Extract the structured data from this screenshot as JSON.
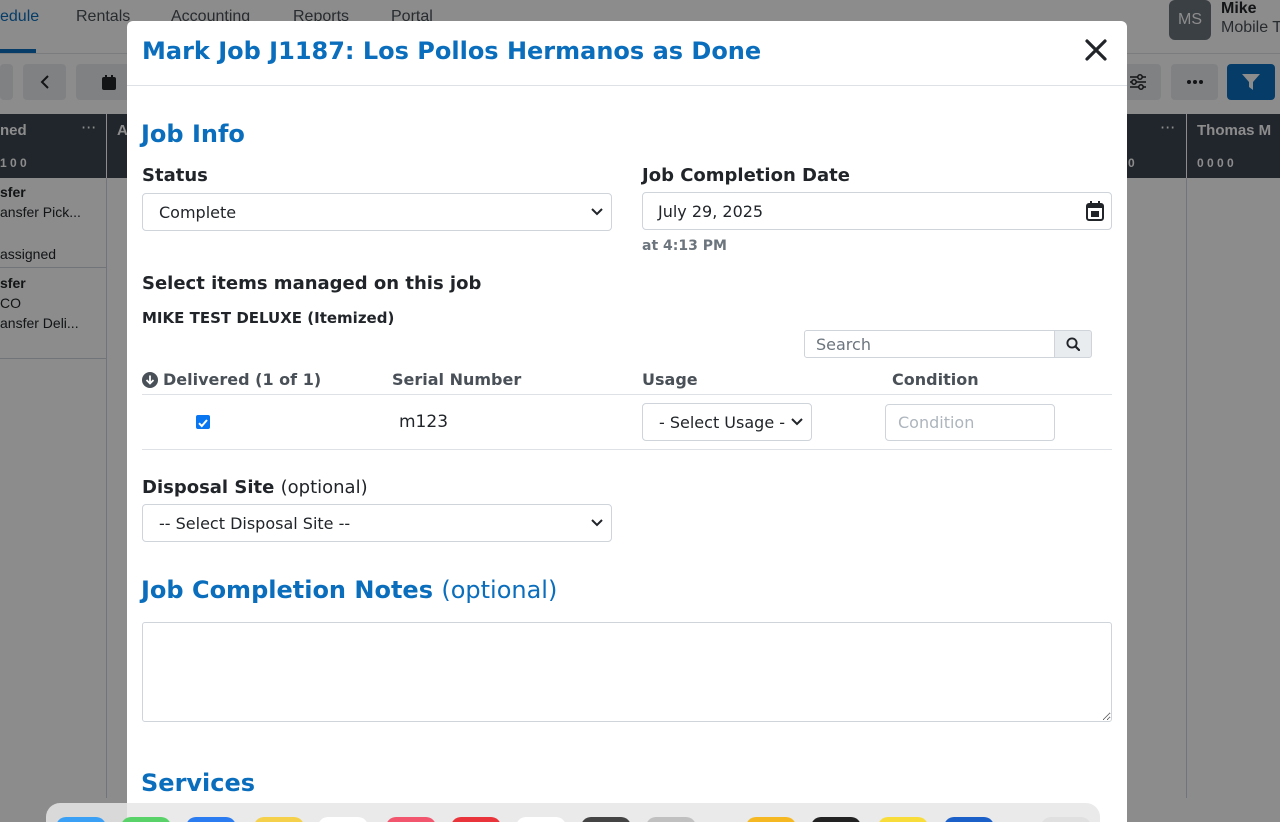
{
  "background": {
    "nav_tabs": [
      {
        "label": "edule"
      },
      {
        "label": "Rentals"
      },
      {
        "label": "Accounting"
      },
      {
        "label": "Reports"
      },
      {
        "label": "Portal"
      }
    ],
    "user": {
      "initials": "MS",
      "name": "Mike",
      "subtitle": "Mobile T"
    },
    "columns": [
      {
        "title": "ned",
        "counts": "1 0 0"
      },
      {
        "title": "A",
        "counts": ""
      },
      {
        "title": "",
        "counts": "0"
      },
      {
        "title": "Thomas M",
        "counts": "0 0 0 0"
      }
    ],
    "cards": [
      {
        "line1": "sfer",
        "line2": "ansfer Pick...",
        "line3": "assigned"
      },
      {
        "line1": "sfer",
        "line2": "CO",
        "line3": "ansfer Deli..."
      }
    ]
  },
  "modal": {
    "title": "Mark Job J1187: Los Pollos Hermanos as Done",
    "job_info": {
      "heading": "Job Info",
      "status_label": "Status",
      "status_value": "Complete",
      "completion_date_label": "Job Completion Date",
      "completion_date_value": "July 29, 2025",
      "completion_time": "at 4:13 PM"
    },
    "items": {
      "heading": "Select items managed on this job",
      "product": "MIKE TEST DELUXE (Itemized)",
      "search_placeholder": "Search",
      "columns": {
        "delivered": "Delivered (1 of 1)",
        "serial": "Serial Number",
        "usage": "Usage",
        "condition": "Condition"
      },
      "rows": [
        {
          "checked": true,
          "serial": "m123",
          "usage": "- Select Usage -",
          "condition_placeholder": "Condition"
        }
      ]
    },
    "disposal": {
      "label": "Disposal Site",
      "optional": "(optional)",
      "value": "-- Select Disposal Site --"
    },
    "notes": {
      "heading": "Job Completion Notes",
      "optional": "(optional)"
    },
    "services": {
      "heading": "Services"
    }
  },
  "colors": {
    "accent": "#0a6ebd",
    "checkbox": "#0a75f0",
    "column_header": "#3d4550"
  }
}
